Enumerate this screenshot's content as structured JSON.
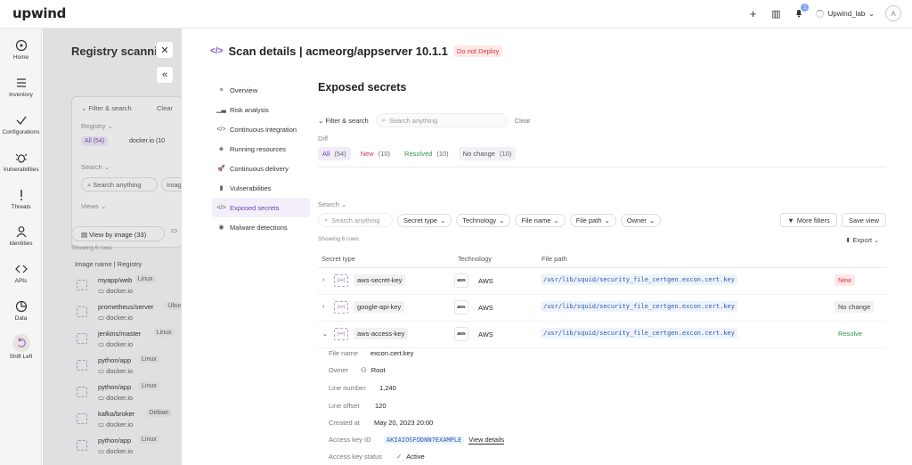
{
  "app": {
    "logo": "upwind"
  },
  "topbar": {
    "add": "+",
    "panels": "▥",
    "notif_count": "1",
    "user": "Upwind_lab",
    "avatar": "A"
  },
  "nav": [
    {
      "label": "Home"
    },
    {
      "label": "Inventory"
    },
    {
      "label": "Configurations"
    },
    {
      "label": "Vulnerabilities"
    },
    {
      "label": "Threats"
    },
    {
      "label": "Identities"
    },
    {
      "label": "APIs"
    },
    {
      "label": "Data"
    },
    {
      "label": "Shift Left"
    }
  ],
  "background": {
    "title": "Registry scanning",
    "filter_search": "Filter & search",
    "clear": "Clear",
    "registry_label": "Registry",
    "all_chip": "All (54)",
    "docker_chip": "docker.io (10",
    "search_label": "Search",
    "search_placeholder": "Search anything",
    "image_btn": "Imag",
    "views_label": "Views",
    "view_by_image": "View by image (33)",
    "showing": "Showing 6 rows",
    "col_header": "Image name | Registry",
    "rows": [
      {
        "name": "myapp/web",
        "tag": "Linux",
        "reg": "docker.io"
      },
      {
        "name": "prometheus/server",
        "tag": "Ubunt",
        "reg": "docker.io"
      },
      {
        "name": "jenkins/master",
        "tag": "Linux",
        "reg": "docker.io"
      },
      {
        "name": "python/app",
        "tag": "Linux",
        "reg": "docker.io"
      },
      {
        "name": "python/app",
        "tag": "Linux",
        "reg": "docker.io"
      },
      {
        "name": "kafka/broker",
        "tag": "Debian",
        "reg": "docker.io"
      },
      {
        "name": "python/app",
        "tag": "Linux",
        "reg": "docker.io"
      }
    ]
  },
  "drawer": {
    "title": "Scan details | acmeorg/appserver 10.1.1",
    "badge": "Do not Deploy",
    "subnav": [
      {
        "label": "Overview",
        "icon": "≡"
      },
      {
        "label": "Risk analysis",
        "icon": "▁▃"
      },
      {
        "label": "Continuous integration",
        "icon": "</>"
      },
      {
        "label": "Running resources",
        "icon": "◈"
      },
      {
        "label": "Continuous delivery",
        "icon": "🚀"
      },
      {
        "label": "Vulnerabilities",
        "icon": "▮"
      },
      {
        "label": "Exposed secrets",
        "icon": "</>"
      },
      {
        "label": "Malware detections",
        "icon": "◉"
      }
    ]
  },
  "secrets": {
    "title": "Exposed secrets",
    "filter_search": "Filter & search",
    "search_placeholder": "Search anything",
    "clear": "Clear",
    "diff_label": "Diff",
    "diff": [
      {
        "label": "All",
        "count": "(54)",
        "color": "#6a3fb5",
        "bg": "#f1ecfa"
      },
      {
        "label": "New",
        "count": "(10)",
        "color": "#d8336b",
        "bg": "transparent"
      },
      {
        "label": "Resolved",
        "count": "(10)",
        "color": "#2f9a54",
        "bg": "transparent"
      },
      {
        "label": "No change",
        "count": "(10)",
        "color": "#555",
        "bg": "#f0f2f7"
      }
    ],
    "search_label": "Search",
    "search2_placeholder": "Search anything",
    "filters": [
      "Secret type",
      "Technology",
      "File name",
      "File path",
      "Owner"
    ],
    "more_filters": "More filters",
    "save_view": "Save view",
    "showing": "Showing 6 rows",
    "export": "Export",
    "cols": {
      "type": "Secret type",
      "tech": "Technology",
      "path": "File path"
    },
    "rows": [
      {
        "chev": "›",
        "type": "aws-secret-key",
        "tech": "AWS",
        "path": "/usr/lib/squid/security_file_certgen.excon.cert.key",
        "status": "New",
        "status_color": "#d33",
        "status_bg": "#fde8e8"
      },
      {
        "chev": "›",
        "type": "google-api-key",
        "tech": "AWS",
        "path": "/usr/lib/squid/security_file_certgen.excon.cert.key",
        "status": "No change",
        "status_color": "#444",
        "status_bg": "#f1f1f1"
      },
      {
        "chev": "⌄",
        "type": "aws-access-key",
        "tech": "AWS",
        "path": "/usr/lib/squid/security_file_certgen.excon.cert.key",
        "status": "Resolve",
        "status_color": "#2f9a54",
        "status_bg": "transparent"
      }
    ],
    "details": {
      "file_name_label": "File name",
      "file_name": "excon.cert.key",
      "owner_label": "Owner",
      "owner": "Root",
      "line_number_label": "Line number",
      "line_number": "1,240",
      "line_offset_label": "Line offset",
      "line_offset": "120",
      "created_label": "Created at",
      "created": "May 20, 2023 20:00",
      "key_label": "Access key ID",
      "key_id": "AKIAIOSFODNN7EXAMPLE",
      "view_details": "View details",
      "status_label": "Access key status",
      "status": "Active"
    }
  }
}
